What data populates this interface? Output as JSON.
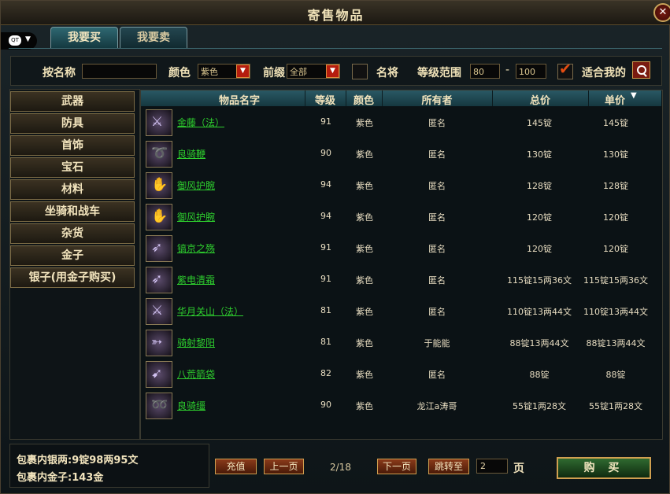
{
  "window": {
    "title": "寄售物品"
  },
  "tabs": [
    {
      "label": "我要买"
    },
    {
      "label": "我要卖"
    }
  ],
  "qq_badge": "QT",
  "filters": {
    "name_label": "按名称",
    "name_value": "",
    "color_label": "颜色",
    "color_value": "紫色",
    "prefix_label": "前缀",
    "prefix_value": "全部",
    "famous_label": "名将",
    "famous_checked": false,
    "level_label": "等级范围",
    "level_min": "80",
    "level_sep": "-",
    "level_max": "100",
    "suit_label": "适合我的",
    "suit_checked": true
  },
  "categories": [
    {
      "label": "武器"
    },
    {
      "label": "防具"
    },
    {
      "label": "首饰"
    },
    {
      "label": "宝石"
    },
    {
      "label": "材料"
    },
    {
      "label": "坐骑和战车"
    },
    {
      "label": "杂货"
    },
    {
      "label": "金子"
    },
    {
      "label": "银子(用金子购买)"
    }
  ],
  "table": {
    "headers": {
      "name": "物品名字",
      "level": "等级",
      "color": "颜色",
      "owner": "所有者",
      "total": "总价",
      "unit": "单价"
    },
    "rows": [
      {
        "icon": "sword-icon",
        "name": "金藤（法）",
        "level": "91",
        "color": "紫色",
        "owner": "匿名",
        "total": "145锭",
        "unit": "145锭"
      },
      {
        "icon": "whip-icon",
        "name": "良骑鞭",
        "level": "90",
        "color": "紫色",
        "owner": "匿名",
        "total": "130锭",
        "unit": "130锭"
      },
      {
        "icon": "bracer-icon",
        "name": "御风护腕",
        "level": "94",
        "color": "紫色",
        "owner": "匿名",
        "total": "128锭",
        "unit": "128锭"
      },
      {
        "icon": "bracer-icon",
        "name": "御风护腕",
        "level": "94",
        "color": "紫色",
        "owner": "匿名",
        "total": "120锭",
        "unit": "120锭"
      },
      {
        "icon": "spear-icon",
        "name": "镐京之殇",
        "level": "91",
        "color": "紫色",
        "owner": "匿名",
        "total": "120锭",
        "unit": "120锭"
      },
      {
        "icon": "spear-icon",
        "name": "紫电清霜",
        "level": "91",
        "color": "紫色",
        "owner": "匿名",
        "total": "115锭15两36文",
        "unit": "115锭15两36文"
      },
      {
        "icon": "sword-icon",
        "name": "华月关山（法）",
        "level": "81",
        "color": "紫色",
        "owner": "匿名",
        "total": "110锭13两44文",
        "unit": "110锭13两44文"
      },
      {
        "icon": "bow-icon",
        "name": "骑射黎阳",
        "level": "81",
        "color": "紫色",
        "owner": "于能能",
        "total": "88锭13两44文",
        "unit": "88锭13两44文"
      },
      {
        "icon": "quiver-icon",
        "name": "八荒箭袋",
        "level": "82",
        "color": "紫色",
        "owner": "匿名",
        "total": "88锭",
        "unit": "88锭"
      },
      {
        "icon": "rein-icon",
        "name": "良骑缰",
        "level": "90",
        "color": "紫色",
        "owner": "龙江a涛哥",
        "total": "55锭1两28文",
        "unit": "55锭1两28文"
      }
    ]
  },
  "wallet": {
    "silver": "包裹内银两:9锭98两95文",
    "gold": "包裹内金子:143金"
  },
  "pagination": {
    "recharge": "充值",
    "prev": "上一页",
    "info": "2/18",
    "next": "下一页",
    "jump": "跳转至",
    "page_value": "2",
    "page_suffix": "页"
  },
  "buy_button": "购 买"
}
